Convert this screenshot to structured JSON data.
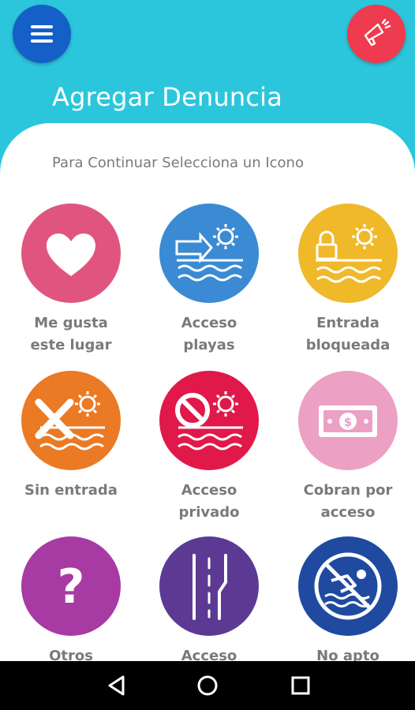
{
  "header": {
    "title": "Agregar Denuncia",
    "menu_icon": "hamburger-menu-icon",
    "alert_icon": "megaphone-icon"
  },
  "content": {
    "subtitle": "Para Continuar Selecciona un Icono"
  },
  "tiles": [
    {
      "label_line1": "Me gusta",
      "label_line2": "este lugar",
      "icon": "heart-icon",
      "color": "#e0557f"
    },
    {
      "label_line1": "Acceso",
      "label_line2": "playas",
      "icon": "beach-access-icon",
      "color": "#3a8ad4"
    },
    {
      "label_line1": "Entrada",
      "label_line2": "bloqueada",
      "icon": "locked-entrance-icon",
      "color": "#f0b92a"
    },
    {
      "label_line1": "Sin entrada",
      "label_line2": "",
      "icon": "no-entrance-icon",
      "color": "#ea7a24"
    },
    {
      "label_line1": "Acceso",
      "label_line2": "privado",
      "icon": "private-access-icon",
      "color": "#e0194a"
    },
    {
      "label_line1": "Cobran por",
      "label_line2": "acceso",
      "icon": "money-icon",
      "color": "#eca0c4"
    },
    {
      "label_line1": "Otros",
      "label_line2": "",
      "icon": "question-icon",
      "color": "#a83aa4"
    },
    {
      "label_line1": "Acceso",
      "label_line2": "",
      "icon": "road-icon",
      "color": "#5c3a94"
    },
    {
      "label_line1": "No apto",
      "label_line2": "",
      "icon": "no-swimming-icon",
      "color": "#1f4aa0"
    }
  ],
  "navbar": {
    "back_icon": "back-triangle-icon",
    "home_icon": "home-circle-icon",
    "recents_icon": "recents-square-icon"
  }
}
